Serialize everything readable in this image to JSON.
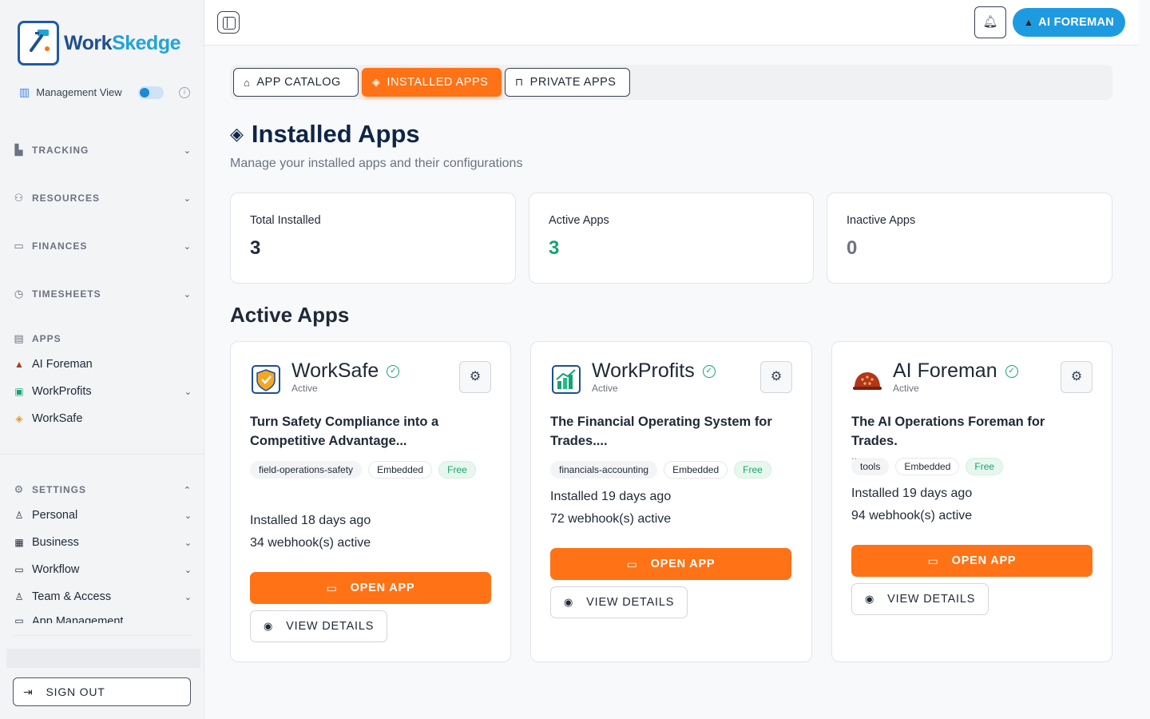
{
  "brand": {
    "name_part1": "Work",
    "name_part2": "Skedge"
  },
  "sidebar": {
    "management_view": "Management View",
    "sections": [
      {
        "label": "TRACKING"
      },
      {
        "label": "RESOURCES"
      },
      {
        "label": "FINANCES"
      },
      {
        "label": "TIMESHEETS"
      },
      {
        "label": "APPS"
      },
      {
        "label": "SETTINGS"
      }
    ],
    "apps": [
      {
        "label": "AI Foreman"
      },
      {
        "label": "WorkProfits"
      },
      {
        "label": "WorkSafe"
      }
    ],
    "settings": [
      {
        "label": "Personal"
      },
      {
        "label": "Business"
      },
      {
        "label": "Workflow"
      },
      {
        "label": "Team & Access"
      },
      {
        "label": "App Management"
      }
    ],
    "sign_out": "SIGN OUT"
  },
  "topbar": {
    "ai_button": "AI FOREMAN"
  },
  "tabs": [
    {
      "label": "APP CATALOG"
    },
    {
      "label": "INSTALLED APPS"
    },
    {
      "label": "PRIVATE APPS"
    }
  ],
  "page": {
    "title": "Installed Apps",
    "subtitle": "Manage your installed apps and their configurations"
  },
  "stats": [
    {
      "label": "Total Installed",
      "value": "3"
    },
    {
      "label": "Active Apps",
      "value": "3"
    },
    {
      "label": "Inactive Apps",
      "value": "0"
    }
  ],
  "section_title": "Active Apps",
  "cards": [
    {
      "name": "WorkSafe",
      "status": "Active",
      "description": "Turn Safety Compliance into a Competitive Advantage...",
      "tags": [
        "field-operations-safety",
        "Embedded",
        "Free"
      ],
      "installed": "Installed 18 days ago",
      "webhooks": "34 webhook(s) active",
      "open_label": "OPEN APP",
      "details_label": "VIEW DETAILS"
    },
    {
      "name": "WorkProfits",
      "status": "Active",
      "description": "The Financial Operating System for Trades....",
      "tags": [
        "financials-accounting",
        "Embedded",
        "Free"
      ],
      "installed": "Installed 19 days ago",
      "webhooks": "72 webhook(s) active",
      "open_label": "OPEN APP",
      "details_label": "VIEW DETAILS"
    },
    {
      "name": "AI Foreman",
      "status": "Active",
      "description": "The AI Operations Foreman for Trades.",
      "description_more": "...",
      "tags": [
        "tools",
        "Embedded",
        "Free"
      ],
      "installed": "Installed 19 days ago",
      "webhooks": "94 webhook(s) active",
      "open_label": "OPEN APP",
      "details_label": "VIEW DETAILS"
    }
  ],
  "colors": {
    "accent": "#ff7215",
    "brand_blue": "#1e9be0",
    "success": "#16a374"
  }
}
